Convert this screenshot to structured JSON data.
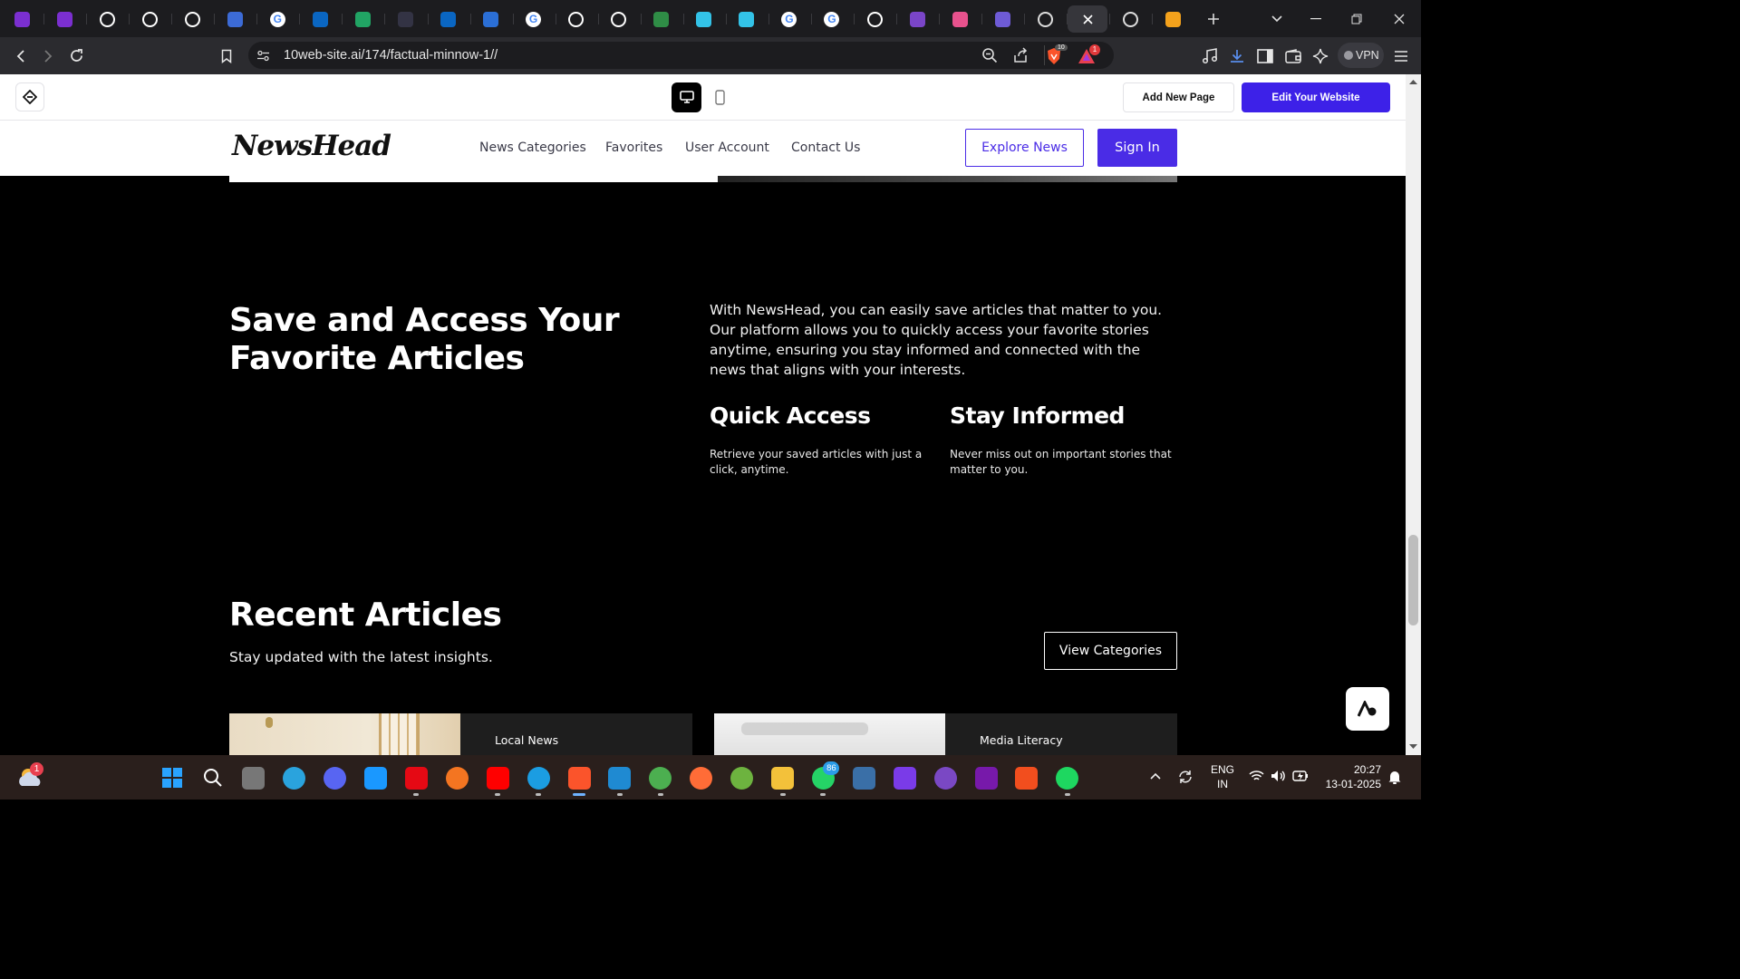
{
  "browser": {
    "url": "10web-site.ai/174/factual-minnow-1//",
    "vpn_label": "VPN",
    "brave_badge": "10",
    "alert_badge": "1",
    "tabs": [
      {
        "icon": "ublock-icon",
        "color": "#7b2fd0"
      },
      {
        "icon": "ublock-icon",
        "color": "#7b2fd0"
      },
      {
        "icon": "github-icon",
        "color": "#ffffff"
      },
      {
        "icon": "openai-icon",
        "color": "#ffffff"
      },
      {
        "icon": "openai-icon",
        "color": "#ffffff"
      },
      {
        "icon": "bitwarden-icon",
        "color": "#3c6bd6"
      },
      {
        "icon": "google-icon",
        "color": "#ffffff"
      },
      {
        "icon": "linkedin-icon",
        "color": "#0a66c2"
      },
      {
        "icon": "sheets-plus-icon",
        "color": "#21a464"
      },
      {
        "icon": "hackernoon-icon",
        "color": "#333344"
      },
      {
        "icon": "linkedin-icon",
        "color": "#0a66c2"
      },
      {
        "icon": "blue-square-icon",
        "color": "#2b6fd6"
      },
      {
        "icon": "google-icon",
        "color": "#ffffff"
      },
      {
        "icon": "github-icon",
        "color": "#ffffff"
      },
      {
        "icon": "github-icon",
        "color": "#ffffff"
      },
      {
        "icon": "geeksforgeeks-icon",
        "color": "#2f8d46"
      },
      {
        "icon": "react-icon",
        "color": "#33c3e8"
      },
      {
        "icon": "react-icon",
        "color": "#33c3e8"
      },
      {
        "icon": "google-icon",
        "color": "#ffffff"
      },
      {
        "icon": "google-icon",
        "color": "#ffffff"
      },
      {
        "icon": "github-icon",
        "color": "#ffffff"
      },
      {
        "icon": "bootstrap-icon",
        "color": "#7a45c8"
      },
      {
        "icon": "dribbble-icon",
        "color": "#e8528d"
      },
      {
        "icon": "code-icon",
        "color": "#6e5bd6"
      },
      {
        "icon": "10web-icon",
        "color": "#dddddd"
      },
      {
        "icon": "close-icon",
        "color": "#ffffff"
      },
      {
        "icon": "globe-icon",
        "color": "#dddddd"
      },
      {
        "icon": "colorful-icon",
        "color": "#f4a21c"
      }
    ]
  },
  "editor": {
    "add_page_label": "Add New Page",
    "edit_label": "Edit Your Website",
    "accent": "#3d21e8"
  },
  "site": {
    "logo": "NewsHead",
    "nav": [
      "News Categories",
      "Favorites",
      "User Account",
      "Contact Us"
    ],
    "explore_label": "Explore News",
    "signin_label": "Sign In",
    "accent": "#4a2ce6"
  },
  "section_save": {
    "title_line1": "Save and Access Your",
    "title_line2": "Favorite Articles",
    "description": "With NewsHead, you can easily save articles that matter to you. Our platform allows you to quickly access your favorite stories anytime, ensuring you stay informed and connected with the news that aligns with your interests.",
    "features": [
      {
        "title": "Quick Access",
        "text": "Retrieve your saved articles with just a click, anytime."
      },
      {
        "title": "Stay Informed",
        "text": "Never miss out on important stories that matter to you."
      }
    ]
  },
  "section_recent": {
    "title": "Recent Articles",
    "subtitle": "Stay updated with the latest insights.",
    "button_label": "View Categories",
    "cards": [
      {
        "category": "Local News"
      },
      {
        "category": "Media Literacy"
      }
    ]
  },
  "taskbar": {
    "weather_badge": "1",
    "whatsapp_badge": "86",
    "lang_line1": "ENG",
    "lang_line2": "IN",
    "time": "20:27",
    "date": "13-01-2025"
  }
}
